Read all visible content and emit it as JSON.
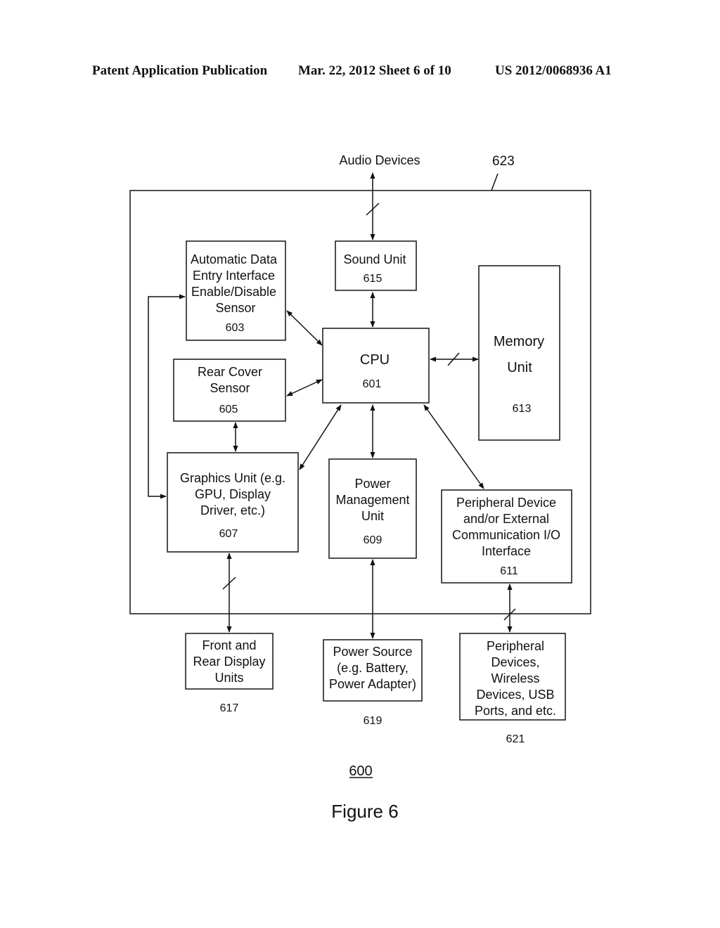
{
  "header": {
    "publication": "Patent Application Publication",
    "date_sheet": "Mar. 22, 2012  Sheet 6 of 10",
    "patent_number": "US 2012/0068936 A1"
  },
  "diagram": {
    "reference": "600",
    "caption": "Figure 6",
    "enclosure_ref": "623",
    "external_top": "Audio Devices",
    "blocks": {
      "adei_sensor": {
        "lines": [
          "Automatic Data",
          "Entry Interface",
          "Enable/Disable",
          "Sensor"
        ],
        "ref": "603"
      },
      "sound_unit": {
        "lines": [
          "Sound Unit"
        ],
        "ref": "615"
      },
      "cpu": {
        "lines": [
          "CPU"
        ],
        "ref": "601"
      },
      "memory_unit": {
        "lines": [
          "Memory",
          "Unit"
        ],
        "ref": "613"
      },
      "rear_cover_sensor": {
        "lines": [
          "Rear Cover",
          "Sensor"
        ],
        "ref": "605"
      },
      "graphics_unit": {
        "lines": [
          "Graphics Unit (e.g.",
          "GPU, Display",
          "Driver, etc.)"
        ],
        "ref": "607"
      },
      "power_management": {
        "lines": [
          "Power",
          "Management",
          "Unit"
        ],
        "ref": "609"
      },
      "peripheral_io": {
        "lines": [
          "Peripheral Device",
          "and/or External",
          "Communication I/O",
          "Interface"
        ],
        "ref": "611"
      },
      "displays": {
        "lines": [
          "Front and",
          "Rear Display",
          "Units"
        ],
        "ref": "617"
      },
      "power_source": {
        "lines": [
          "Power Source",
          "(e.g. Battery,",
          "Power Adapter)"
        ],
        "ref": "619"
      },
      "peripheral_devices": {
        "lines": [
          "Peripheral",
          "Devices,",
          "Wireless",
          "Devices, USB",
          "Ports, and etc."
        ],
        "ref": "621"
      }
    }
  }
}
